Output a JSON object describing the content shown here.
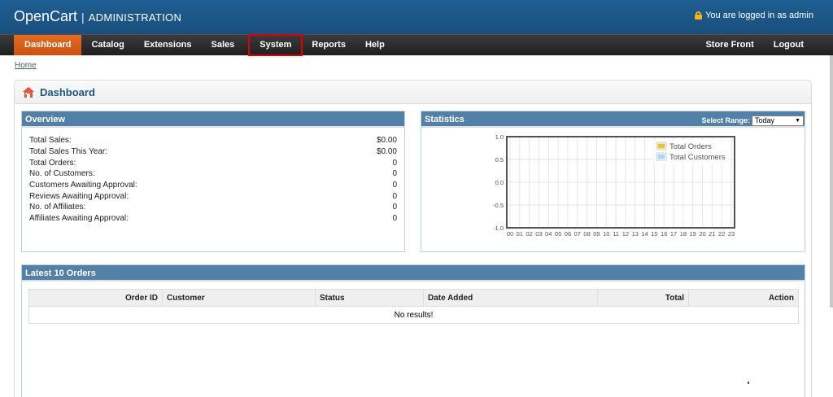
{
  "header": {
    "brand": "OpenCart",
    "separator": "|",
    "subtitle": "ADMINISTRATION",
    "login_status": "You are logged in as admin"
  },
  "menu": {
    "left": [
      "Dashboard",
      "Catalog",
      "Extensions",
      "Sales",
      "System",
      "Reports",
      "Help"
    ],
    "right": [
      "Store Front",
      "Logout"
    ],
    "active": "Dashboard",
    "highlighted": "System"
  },
  "breadcrumb": {
    "home": "Home"
  },
  "page": {
    "title": "Dashboard"
  },
  "overview": {
    "title": "Overview",
    "rows": [
      {
        "label": "Total Sales:",
        "value": "$0.00"
      },
      {
        "label": "Total Sales This Year:",
        "value": "$0.00"
      },
      {
        "label": "Total Orders:",
        "value": "0"
      },
      {
        "label": "No. of Customers:",
        "value": "0"
      },
      {
        "label": "Customers Awaiting Approval:",
        "value": "0"
      },
      {
        "label": "Reviews Awaiting Approval:",
        "value": "0"
      },
      {
        "label": "No. of Affiliates:",
        "value": "0"
      },
      {
        "label": "Affiliates Awaiting Approval:",
        "value": "0"
      }
    ]
  },
  "statistics": {
    "title": "Statistics",
    "range_label": "Select Range:",
    "range_value": "Today"
  },
  "chart_data": {
    "type": "line",
    "x": [
      "00",
      "01",
      "02",
      "03",
      "04",
      "05",
      "06",
      "07",
      "08",
      "09",
      "10",
      "11",
      "12",
      "13",
      "14",
      "15",
      "16",
      "17",
      "18",
      "19",
      "20",
      "21",
      "22",
      "23"
    ],
    "series": [
      {
        "name": "Total Orders",
        "color": "#edc240",
        "values": []
      },
      {
        "name": "Total Customers",
        "color": "#afd8f8",
        "values": []
      }
    ],
    "y_ticks": [
      "1.0",
      "0.5",
      "0.0",
      "-0.5",
      "-1.0"
    ],
    "ylim": [
      -1.0,
      1.0
    ],
    "grid": true,
    "legend": "top-right"
  },
  "orders": {
    "title": "Latest 10 Orders",
    "columns": [
      "Order ID",
      "Customer",
      "Status",
      "Date Added",
      "Total",
      "Action"
    ],
    "empty": "No results!"
  },
  "colors": {
    "header": "#1e5e92",
    "menu": "#2b2b2b",
    "active_tab": "#d95f1b",
    "panel_head": "#5380a7",
    "title": "#1c5583"
  }
}
